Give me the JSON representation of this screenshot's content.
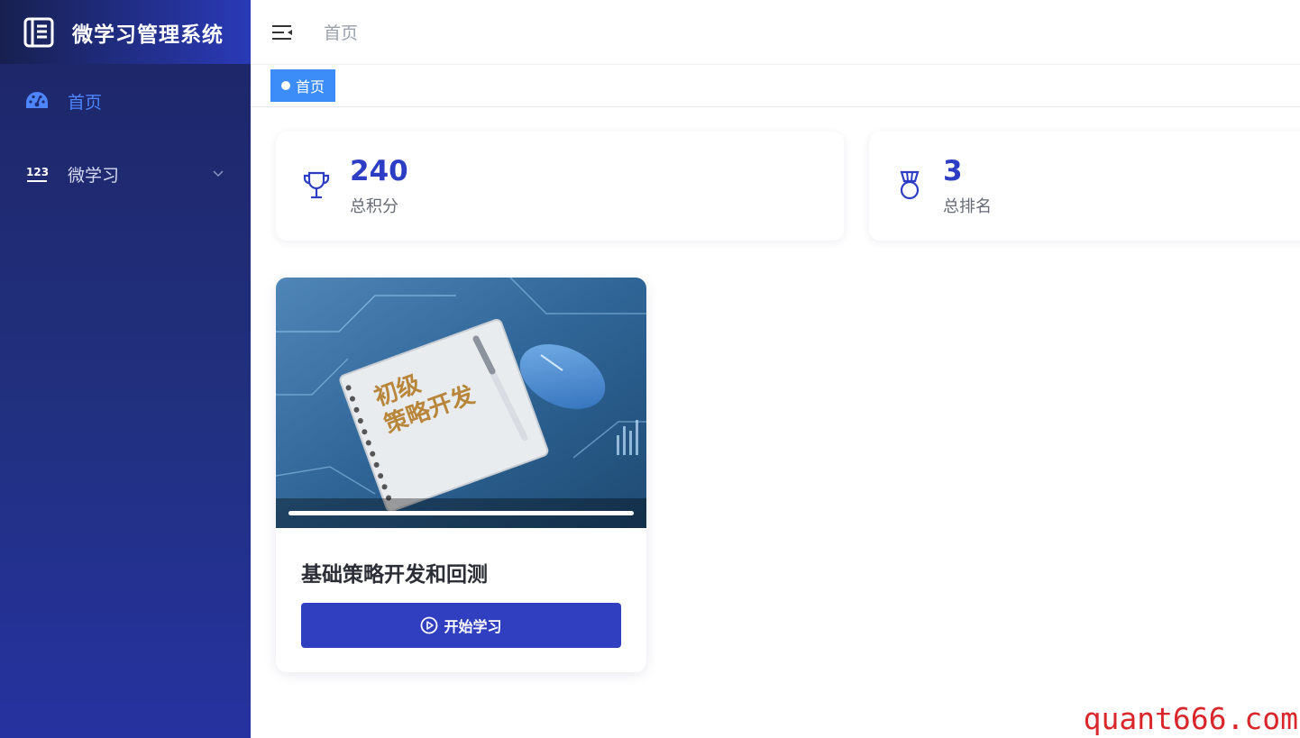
{
  "app": {
    "title": "微学习管理系统"
  },
  "sidebar": {
    "items": [
      {
        "label": "首页",
        "icon": "dashboard-icon",
        "active": true
      },
      {
        "label": "微学习",
        "icon": "numbers-123-icon",
        "active": false
      }
    ]
  },
  "header": {
    "breadcrumb": "首页"
  },
  "tags": [
    {
      "label": "首页",
      "active": true
    }
  ],
  "stats": [
    {
      "value": "240",
      "label": "总积分",
      "icon": "trophy-icon"
    },
    {
      "value": "3",
      "label": "总排名",
      "icon": "medal-icon"
    }
  ],
  "course": {
    "cover_text_line1": "初级",
    "cover_text_line2": "策略开发",
    "title": "基础策略开发和回测",
    "button_label": "开始学习",
    "progress": 1.0
  },
  "watermark": "quant666.com",
  "colors": {
    "accent": "#2f3fc0",
    "tag": "#3c8df7",
    "sidebar_active": "#4d86ff",
    "watermark": "#d8262b"
  }
}
